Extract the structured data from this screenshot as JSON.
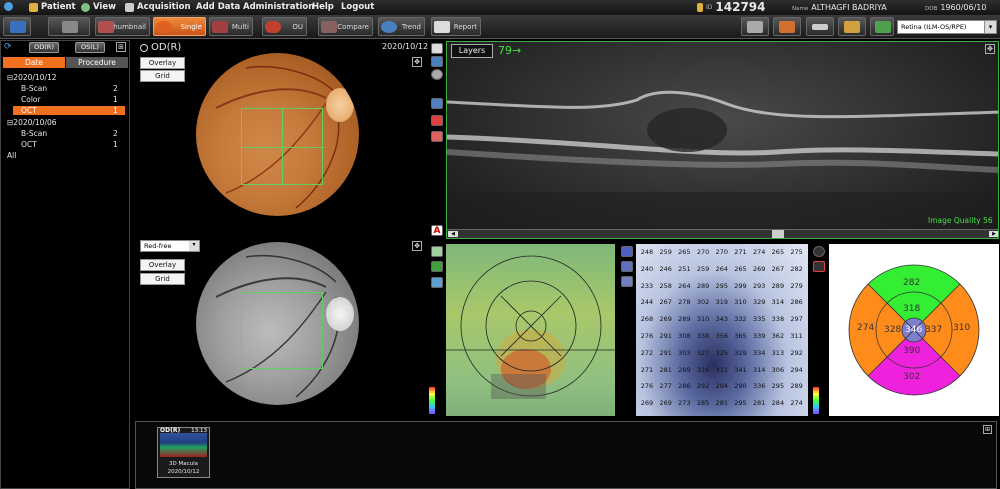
{
  "menu": {
    "patient": "Patient",
    "view": "View",
    "acquisition": "Acquisition",
    "add_data": "Add Data",
    "administration": "Administration",
    "help": "Help",
    "logout": "Logout"
  },
  "patient_info": {
    "id_label": "ID",
    "id": "142794",
    "name_label": "Name",
    "name": "ALTHAGFI BADRIYA",
    "dob_label": "DOB",
    "dob": "1960/06/10"
  },
  "toolbar": {
    "thumbnail": "Thumbnail",
    "single": "Single",
    "multi": "Multi",
    "ou": "OU",
    "compare": "Compare",
    "trend": "Trend",
    "report": "Report",
    "retina_select": "Retina (ILM-OS/RPE)"
  },
  "left_panel": {
    "od": "OD(R)",
    "os": "OS(L)",
    "tab_date": "Date",
    "tab_procedure": "Procedure",
    "tree": [
      {
        "label": "2020/10/12",
        "count": ""
      },
      {
        "label": "B-Scan",
        "count": "2"
      },
      {
        "label": "Color",
        "count": "1"
      },
      {
        "label": "OCT",
        "count": "1"
      },
      {
        "label": "2020/10/06",
        "count": ""
      },
      {
        "label": "B-Scan",
        "count": "2"
      },
      {
        "label": "OCT",
        "count": "1"
      },
      {
        "label": "All",
        "count": ""
      }
    ]
  },
  "main": {
    "eye_title": "OD(R)",
    "date": "2020/10/12",
    "overlay": "Overlay",
    "grid": "Grid",
    "overlay2": "Overlay",
    "grid2": "Grid",
    "filter": "Red-free",
    "layers": "Layers",
    "slice": "79→",
    "image_quality": "Image Quality 56"
  },
  "thickness_grid": [
    [
      "248",
      "259",
      "265",
      "270",
      "270",
      "271",
      "274",
      "265",
      "275"
    ],
    [
      "240",
      "246",
      "251",
      "259",
      "264",
      "265",
      "269",
      "267",
      "282"
    ],
    [
      "233",
      "258",
      "264",
      "289",
      "295",
      "299",
      "293",
      "289",
      "279"
    ],
    [
      "244",
      "267",
      "278",
      "302",
      "319",
      "310",
      "329",
      "314",
      "286"
    ],
    [
      "268",
      "269",
      "289",
      "310",
      "343",
      "332",
      "335",
      "338",
      "297"
    ],
    [
      "276",
      "291",
      "308",
      "338",
      "356",
      "365",
      "339",
      "362",
      "311"
    ],
    [
      "272",
      "291",
      "303",
      "327",
      "325",
      "329",
      "334",
      "313",
      "292"
    ],
    [
      "271",
      "281",
      "289",
      "316",
      "311",
      "341",
      "314",
      "306",
      "294"
    ],
    [
      "276",
      "277",
      "286",
      "292",
      "294",
      "290",
      "336",
      "295",
      "289"
    ],
    [
      "269",
      "269",
      "273",
      "285",
      "281",
      "295",
      "281",
      "284",
      "274"
    ]
  ],
  "thickness_map": {
    "top": "282",
    "inner_top": "318",
    "left": "274",
    "inner_left": "328",
    "center": "346",
    "inner_right": "337",
    "right": "310",
    "inner_bottom": "390",
    "bottom": "302"
  },
  "thumbnail": {
    "eye": "OD(R)",
    "time": "13:13",
    "label": "3D Macula",
    "date": "2020/10/12"
  },
  "colors": {
    "accent": "#f07020",
    "oct_border": "#3cb03c",
    "green_text": "#47e047",
    "sector_green": "#33ee33",
    "sector_orange": "#ff8c1a",
    "sector_magenta": "#ee22dd"
  }
}
